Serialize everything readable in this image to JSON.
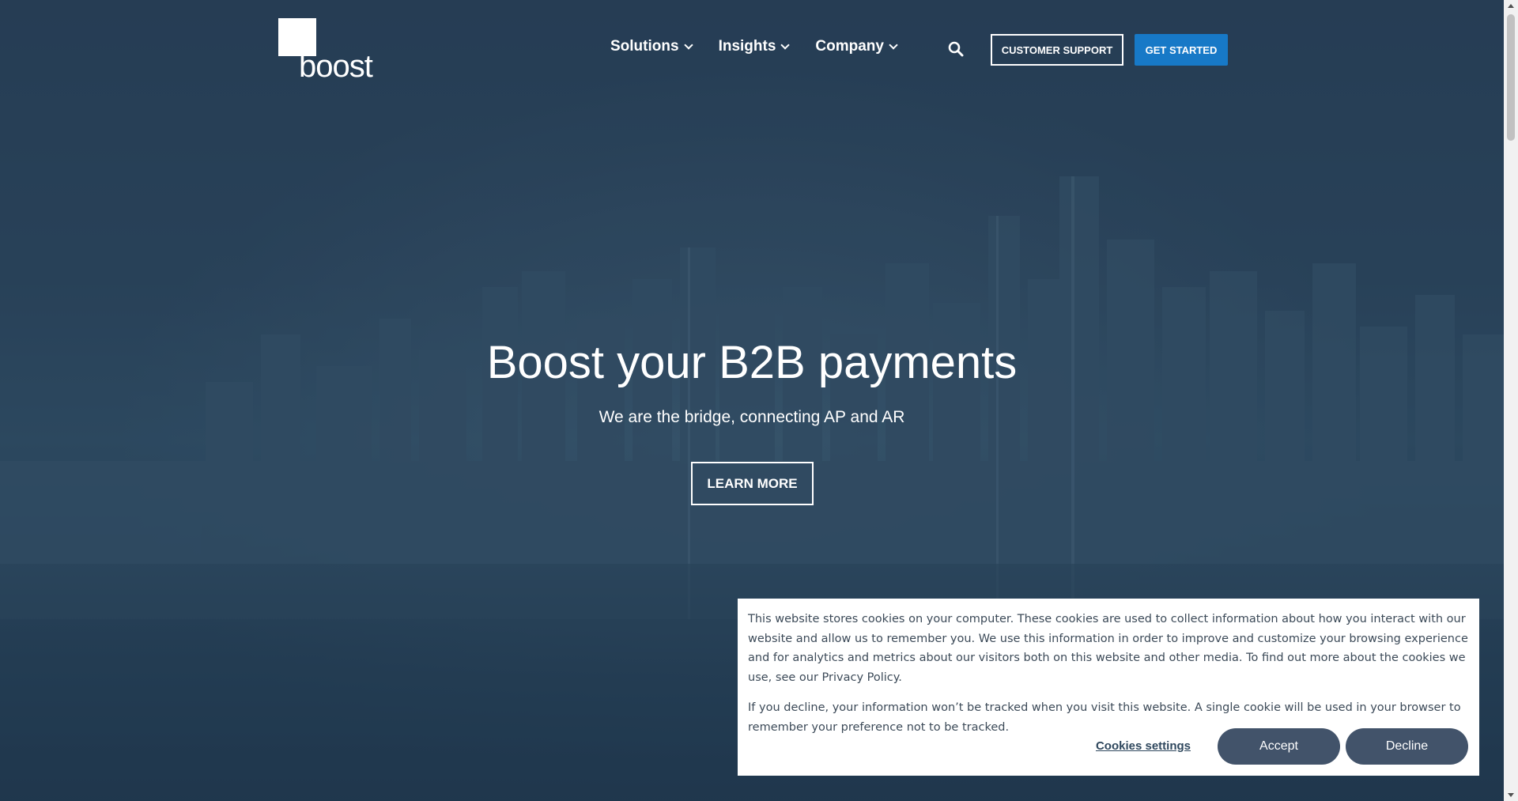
{
  "header": {
    "logo_text": "boost",
    "nav": [
      {
        "label": "Solutions"
      },
      {
        "label": "Insights"
      },
      {
        "label": "Company"
      }
    ],
    "customer_support_label": "CUSTOMER SUPPORT",
    "get_started_label": "GET STARTED"
  },
  "hero": {
    "title": "Boost your B2B payments",
    "subtitle": "We are the bridge, connecting AP and AR",
    "cta_label": "LEARN MORE"
  },
  "cookie_banner": {
    "paragraph_1": "This website stores cookies on your computer. These cookies are used to collect information about how you interact with our website and allow us to remember you. We use this information in order to improve and customize your browsing experience and for analytics and metrics about our visitors both on this website and other media. To find out more about the cookies we use, see our Privacy Policy.",
    "paragraph_2": "If you decline, your information won’t be tracked when you visit this website. A single cookie will be used in your browser to remember your preference not to be tracked.",
    "settings_label": "Cookies settings",
    "accept_label": "Accept",
    "decline_label": "Decline"
  },
  "colors": {
    "brand_blue": "#1779c7",
    "hero_overlay": "#2a4258",
    "cookie_button": "#42536a"
  },
  "icons": {
    "search": "search-icon",
    "dropdown": "chevron-down-icon"
  }
}
